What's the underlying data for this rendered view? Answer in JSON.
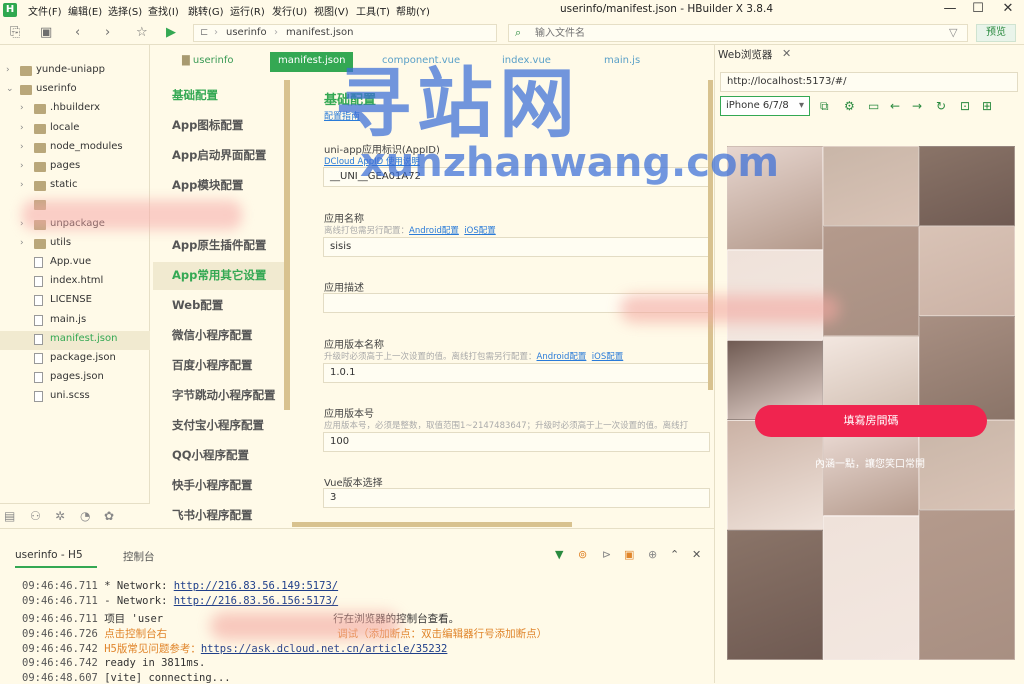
{
  "titlebar": {
    "menus": [
      "文件(F)",
      "编辑(E)",
      "选择(S)",
      "查找(I)",
      "跳转(G)",
      "运行(R)",
      "发行(U)",
      "视图(V)",
      "工具(T)",
      "帮助(Y)"
    ],
    "title": "userinfo/manifest.json - HBuilder X 3.8.4",
    "logo": "H"
  },
  "toolbar": {
    "breadcrumb": [
      "userinfo",
      "manifest.json"
    ],
    "file_placeholder": "输入文件名",
    "preview_label": "预览"
  },
  "sidebar": {
    "items": [
      {
        "label": "yunde-uniapp",
        "type": "folder",
        "depth": 0,
        "arrow": "›"
      },
      {
        "label": "userinfo",
        "type": "folder",
        "depth": 0,
        "arrow": "⌄"
      },
      {
        "label": ".hbuilderx",
        "type": "folder",
        "depth": 1,
        "arrow": "›"
      },
      {
        "label": "locale",
        "type": "folder",
        "depth": 1,
        "arrow": "›"
      },
      {
        "label": "node_modules",
        "type": "folder",
        "depth": 1,
        "arrow": "›"
      },
      {
        "label": "pages",
        "type": "folder",
        "depth": 1,
        "arrow": "›"
      },
      {
        "label": "static",
        "type": "folder",
        "depth": 1,
        "arrow": "›"
      },
      {
        "label": "",
        "type": "folder",
        "depth": 1,
        "arrow": ""
      },
      {
        "label": "unpackage",
        "type": "folder",
        "depth": 1,
        "arrow": "›"
      },
      {
        "label": "utils",
        "type": "folder",
        "depth": 1,
        "arrow": "›"
      },
      {
        "label": "App.vue",
        "type": "file",
        "depth": 1,
        "arrow": ""
      },
      {
        "label": "index.html",
        "type": "file",
        "depth": 1,
        "arrow": ""
      },
      {
        "label": "LICENSE",
        "type": "file",
        "depth": 1,
        "arrow": ""
      },
      {
        "label": "main.js",
        "type": "file",
        "depth": 1,
        "arrow": ""
      },
      {
        "label": "manifest.json",
        "type": "file",
        "depth": 1,
        "arrow": "",
        "active": true
      },
      {
        "label": "package.json",
        "type": "file",
        "depth": 1,
        "arrow": ""
      },
      {
        "label": "pages.json",
        "type": "file",
        "depth": 1,
        "arrow": ""
      },
      {
        "label": "uni.scss",
        "type": "file",
        "depth": 1,
        "arrow": ""
      }
    ]
  },
  "editor_tabs": [
    "userinfo",
    "manifest.json",
    "component.vue",
    "index.vue",
    "main.js"
  ],
  "settings_nav": [
    "基础配置",
    "App图标配置",
    "App启动界面配置",
    "App模块配置",
    "",
    "App原生插件配置",
    "App常用其它设置",
    "Web配置",
    "微信小程序配置",
    "百度小程序配置",
    "字节跳动小程序配置",
    "支付宝小程序配置",
    "QQ小程序配置",
    "快手小程序配置",
    "飞书小程序配置"
  ],
  "form": {
    "section_title": "基础配置",
    "section_link": "配置指南",
    "appid_label": "uni-app应用标识(AppID)",
    "appid_hint": "DCloud AppID 使用说明",
    "appid_value": "__UNI__GEA01A72",
    "name_label": "应用名称",
    "name_hint": "离线打包需另行配置：",
    "android_link": "Android配置",
    "ios_link": "iOS配置",
    "name_value": "sisis",
    "desc_label": "应用描述",
    "desc_value": "",
    "version_name_label": "应用版本名称",
    "version_name_hint": "升级时必须高于上一次设置的值。离线打包需另行配置：",
    "version_name_value": "1.0.1",
    "version_code_label": "应用版本号",
    "version_code_hint": "应用版本号，必须是整数，取值范围1~2147483647；升级时必须高于上一次设置的值。离线打",
    "version_code_value": "100",
    "vue_label": "Vue版本选择",
    "vue_value": "3"
  },
  "watermark": {
    "line1": "寻站网",
    "line2": "xunzhanwang.com"
  },
  "browser": {
    "tab_label": "Web浏览器",
    "url": "http://localhost:5173/#/",
    "device": "iPhone 6/7/8",
    "button_label": "填寫房間碼",
    "subtext": "內涵一點，讓您笑口常開"
  },
  "console": {
    "tabs": [
      "userinfo - H5",
      "控制台"
    ],
    "lines": [
      {
        "time": "09:46:46.711",
        "text": "  * Network: ",
        "link": "http://216.83.56.149:5173/",
        "style": "normal"
      },
      {
        "time": "09:46:46.711",
        "text": "  - Network: ",
        "link": "http://216.83.56.156:5173/",
        "style": "normal"
      },
      {
        "time": "09:46:46.711",
        "text": "项目 'user",
        "link": "",
        "tail": "行在浏览器的控制台查看。",
        "style": "normal"
      },
      {
        "time": "09:46:46.726",
        "text": "点击控制台右",
        "link": "",
        "tail": "调试（添加断点：双击编辑器行号添加断点）",
        "style": "orange"
      },
      {
        "time": "09:46:46.742",
        "text": "H5版常见问题参考：",
        "link": "https://ask.dcloud.net.cn/article/35232",
        "style": "orange"
      },
      {
        "time": "09:46:46.742",
        "text": "  ready in 3811ms.",
        "link": "",
        "style": "normal"
      },
      {
        "time": "09:46:48.607",
        "text": "[vite] connecting...",
        "link": "",
        "style": "normal"
      }
    ]
  }
}
